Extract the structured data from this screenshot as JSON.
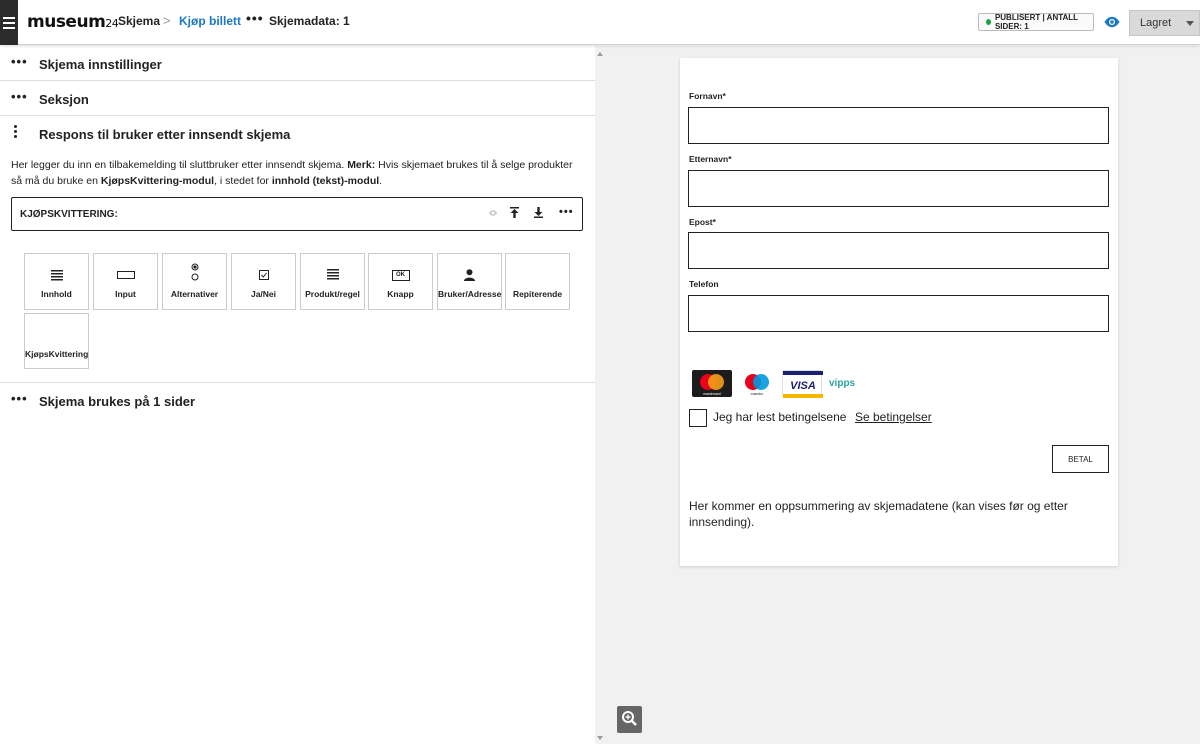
{
  "topbar": {
    "logo_main": "museum",
    "logo_num": "24",
    "crumb_1": "Skjema",
    "crumb_sep": ">",
    "crumb_2": "Kjøp billett",
    "crumb_dots": "•••",
    "crumb_3": "Skjemadata: 1",
    "status": "PUBLISERT | ANTALL SIDER: 1",
    "save_label": "Lagret",
    "accent": "#1a78c2"
  },
  "left": {
    "dots": "•••",
    "sections": [
      {
        "title": "Skjema innstillinger"
      },
      {
        "title": "Seksjon"
      },
      {
        "title": "Respons til bruker etter innsendt skjema"
      },
      {
        "title": "Skjema brukes på 1 sider"
      }
    ],
    "desc": {
      "p1": "Her legger du inn en tilbakemelding til sluttbruker etter innsendt skjema. ",
      "b1": "Merk:",
      "p2": " Hvis skjemaet brukes til å selge produkter så må du bruke en ",
      "b2": "KjøpsKvittering-modul",
      "p3": ", i stedet for ",
      "b3": "innhold (tekst)-modul",
      "p4": "."
    },
    "module": {
      "label": "KJØPSKVITTERING:",
      "more": "•••"
    },
    "tiles": [
      {
        "label": "Innhold",
        "icon": "lines-icon"
      },
      {
        "label": "Input",
        "icon": "input-box-icon"
      },
      {
        "label": "Alternativer",
        "icon": "radio-icon"
      },
      {
        "label": "Ja/Nei",
        "icon": "checkbox-icon"
      },
      {
        "label": "Produkt/regel",
        "icon": "product-lines-icon"
      },
      {
        "label": "Knapp",
        "icon": "ok-button-icon",
        "icon_text": "OK"
      },
      {
        "label": "Bruker/Adresse",
        "icon": "person-icon"
      },
      {
        "label": "Repiterende",
        "icon": "none"
      },
      {
        "label": "KjøpsKvittering",
        "icon": "none"
      }
    ]
  },
  "form": {
    "fields": [
      {
        "label": "Fornavn*",
        "value": ""
      },
      {
        "label": "Etternavn*",
        "value": ""
      },
      {
        "label": "Epost*",
        "value": ""
      },
      {
        "label": "Telefon",
        "value": ""
      }
    ],
    "payments": {
      "mastercard_text": "mastercard",
      "maestro_text": "maestro",
      "visa_text": "VISA",
      "vipps_text": "vipps"
    },
    "terms_text": "Jeg har lest betingelsene",
    "terms_link": "Se betingelser",
    "pay_button": "BETAL",
    "summary": "Her kommer en oppsummering av skjemadatene (kan vises før og etter innsending)."
  }
}
